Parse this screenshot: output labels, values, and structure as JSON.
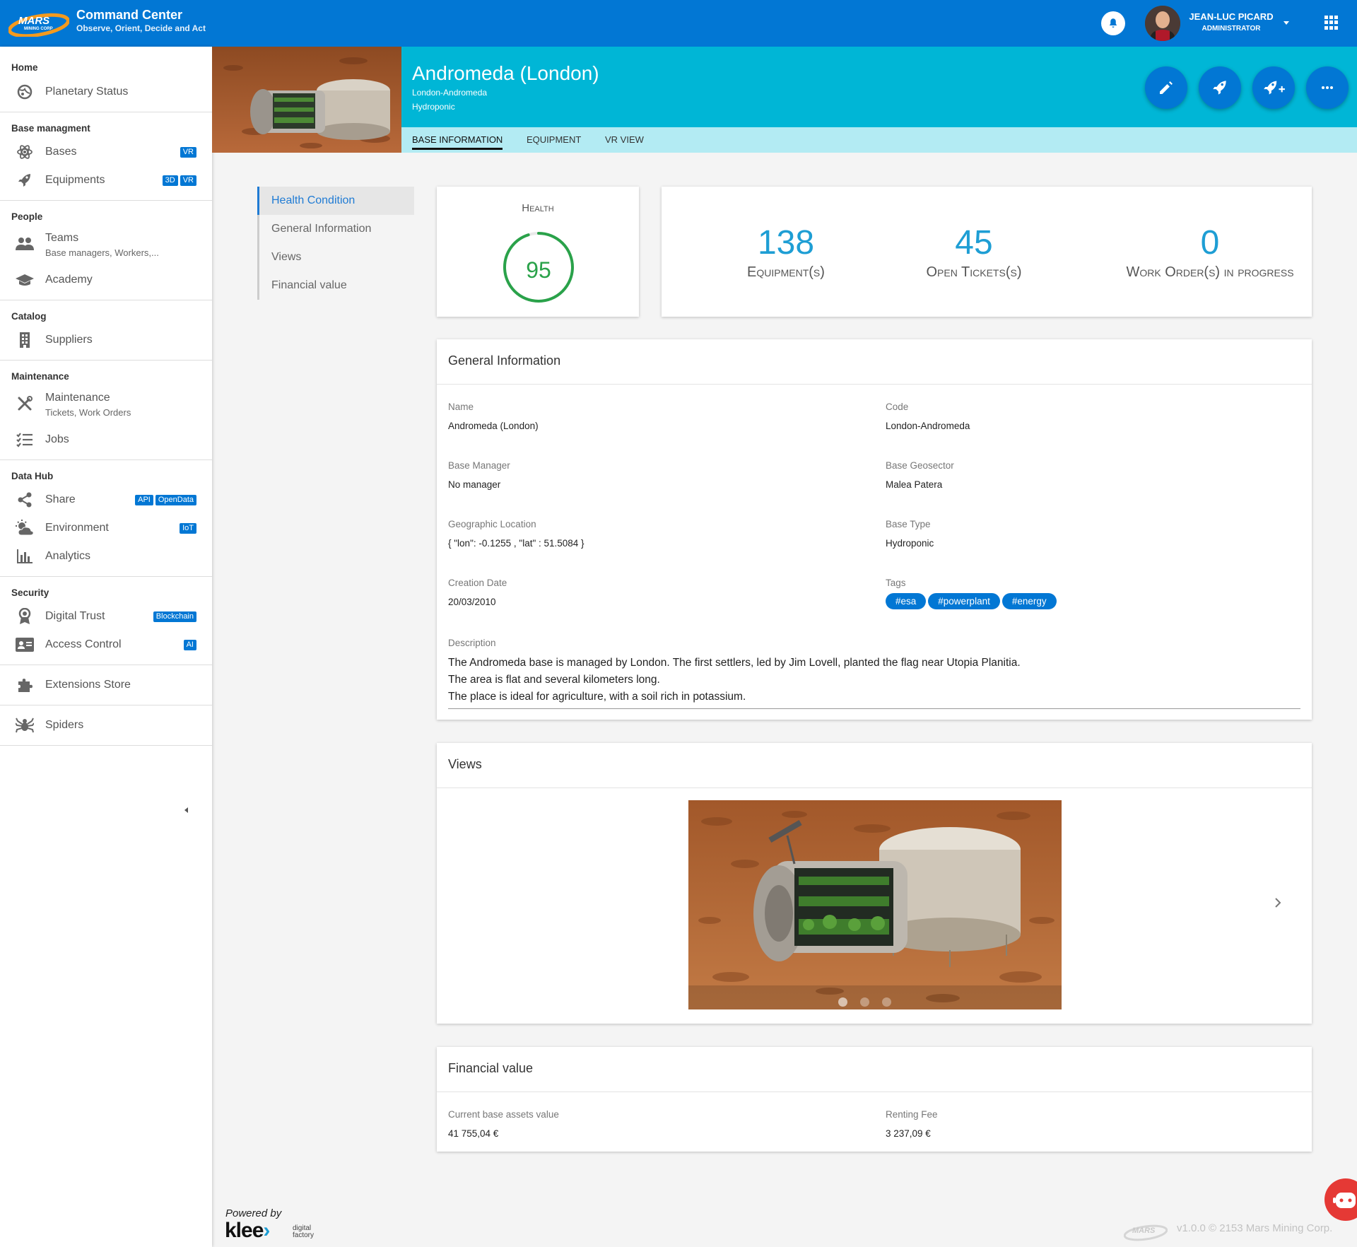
{
  "header": {
    "logo_text": "MARS",
    "logo_sub": "MINING CORP",
    "app_title": "Command Center",
    "app_subtitle": "Observe, Orient, Decide and Act",
    "user_name": "JEAN-LUC PICARD",
    "user_role": "ADMINISTRATOR"
  },
  "sidebar": {
    "sections": {
      "home": "Home",
      "base": "Base managment",
      "people": "People",
      "catalog": "Catalog",
      "maintenance": "Maintenance",
      "datahub": "Data Hub",
      "security": "Security"
    },
    "items": {
      "planetary": "Planetary Status",
      "bases": "Bases",
      "bases_badge": "VR",
      "equipments": "Equipments",
      "equip_badge1": "3D",
      "equip_badge2": "VR",
      "teams": "Teams",
      "teams_sub": "Base managers, Workers,...",
      "academy": "Academy",
      "suppliers": "Suppliers",
      "maintenance": "Maintenance",
      "maintenance_sub": "Tickets, Work Orders",
      "jobs": "Jobs",
      "share": "Share",
      "share_badge1": "API",
      "share_badge2": "OpenData",
      "environment": "Environment",
      "env_badge": "IoT",
      "analytics": "Analytics",
      "digital_trust": "Digital Trust",
      "trust_badge": "Blockchain",
      "access_control": "Access Control",
      "access_badge": "AI",
      "extensions": "Extensions Store",
      "spiders": "Spiders"
    },
    "powered_by": "Powered by",
    "klee": "klee",
    "klee_sub1": "digital",
    "klee_sub2": "factory"
  },
  "base": {
    "title": "Andromeda (London)",
    "code": "London-Andromeda",
    "type": "Hydroponic"
  },
  "tabs": {
    "base_info": "BASE INFORMATION",
    "equipment": "EQUIPMENT",
    "vr_view": "VR VIEW"
  },
  "anchors": {
    "health": "Health Condition",
    "general": "General Information",
    "views": "Views",
    "financial": "Financial value"
  },
  "health": {
    "title": "Health",
    "value": "95",
    "fraction": 0.95
  },
  "stats": {
    "equipment_count": "138",
    "equipment_label": "Equipment(s)",
    "tickets_count": "45",
    "tickets_label": "Open Tickets(s)",
    "workorders_count": "0",
    "workorders_label": "Work Order(s) in progress"
  },
  "general": {
    "title": "General Information",
    "name_label": "Name",
    "name_value": "Andromeda (London)",
    "code_label": "Code",
    "code_value": "London-Andromeda",
    "manager_label": "Base Manager",
    "manager_value": "No manager",
    "geosector_label": "Base Geosector",
    "geosector_value": "Malea Patera",
    "location_label": "Geographic Location",
    "location_value": "{ \"lon\": -0.1255 , \"lat\" : 51.5084 }",
    "type_label": "Base Type",
    "type_value": "Hydroponic",
    "date_label": "Creation Date",
    "date_value": "20/03/2010",
    "tags_label": "Tags",
    "tags": [
      "#esa",
      "#powerplant",
      "#energy"
    ],
    "desc_label": "Description",
    "desc_lines": [
      "The Andromeda base is managed by London. The first settlers, led by Jim Lovell, planted the flag near Utopia Planitia.",
      "The area is flat and several kilometers long.",
      "The place is ideal for agriculture, with a soil rich in potassium."
    ]
  },
  "views": {
    "title": "Views",
    "slide_index": 1,
    "slide_count": 3
  },
  "financial": {
    "title": "Financial value",
    "assets_label": "Current base assets value",
    "assets_value": "41 755,04 €",
    "fee_label": "Renting Fee",
    "fee_value": "3 237,09 €"
  },
  "footer": {
    "logo_text": "MARS",
    "text": "v1.0.0 © 2153 Mars Mining Corp."
  },
  "colors": {
    "primary": "#0277d4",
    "banner": "#00b6d6",
    "tabbar": "#b3ebf3",
    "stat": "#1e9ed4",
    "health": "#2aa24a"
  }
}
